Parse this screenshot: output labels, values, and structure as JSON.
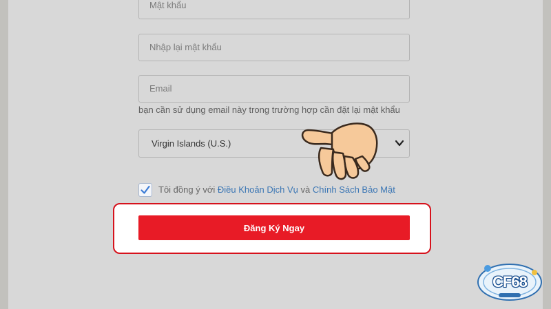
{
  "form": {
    "password_placeholder": "Mật khẩu",
    "confirm_password_placeholder": "Nhập lại mật khẩu",
    "email_placeholder": "Email",
    "email_hint": "bạn cần sử dụng email này trong trường hợp cần đặt lại mật khẩu",
    "country_value": "Virgin Islands (U.S.)",
    "terms_prefix": "Tôi đồng ý với ",
    "terms_link": "Điều Khoản Dịch Vụ",
    "terms_and": " và ",
    "privacy_link": "Chính Sách Bảo Mật",
    "terms_checked": true,
    "submit_label": "Đăng Ký Ngay"
  },
  "logo": {
    "text": "CF68"
  },
  "colors": {
    "accent_red": "#e81b26",
    "highlight_border": "#d6121c",
    "link_blue": "#3b76b4",
    "checkbox_blue": "#3a7bd5"
  },
  "icons": {
    "pointer": "pointing-hand-icon",
    "select_arrow": "chevron-down-icon",
    "check": "checkmark-icon"
  }
}
